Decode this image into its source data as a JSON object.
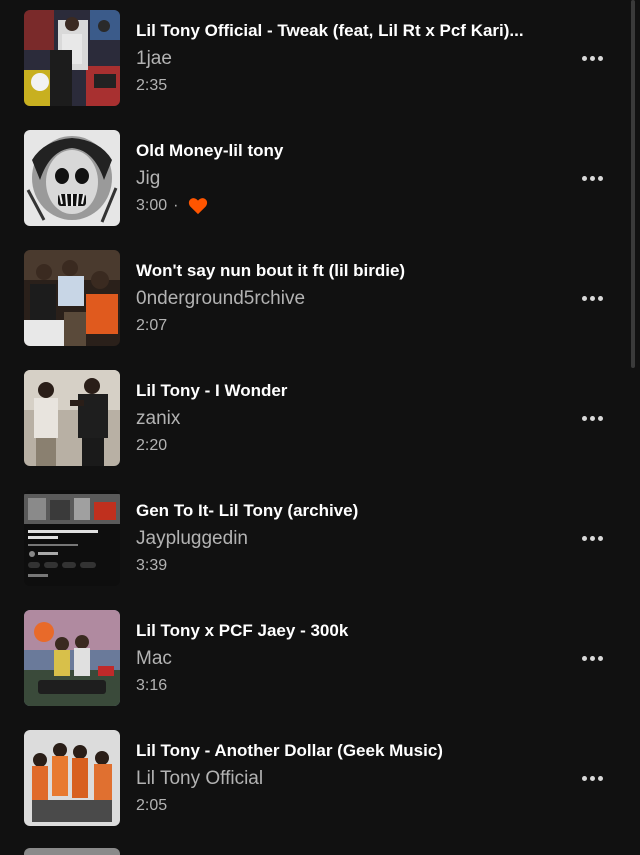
{
  "tracks": [
    {
      "title": "Lil Tony Official - Tweak (feat, Lil Rt x Pcf Kari)...",
      "artist": "1jae",
      "duration": "2:35",
      "liked": false,
      "art_icon": "collage-artwork"
    },
    {
      "title": "Old Money-lil tony",
      "artist": "Jig",
      "duration": "3:00",
      "liked": true,
      "art_icon": "horror-face-artwork"
    },
    {
      "title": "Won't say nun bout it ft (lil birdie)",
      "artist": "0nderground5rchive",
      "duration": "2:07",
      "liked": false,
      "art_icon": "group-photo-artwork"
    },
    {
      "title": "Lil Tony - I Wonder",
      "artist": "zanix",
      "duration": "2:20",
      "liked": false,
      "art_icon": "two-people-photo-artwork"
    },
    {
      "title": "Gen To It- Lil Tony (archive)",
      "artist": "Jaypluggedin",
      "duration": "3:39",
      "liked": false,
      "art_icon": "video-screenshot-artwork"
    },
    {
      "title": "Lil Tony x PCF Jaey - 300k",
      "artist": "Mac",
      "duration": "3:16",
      "liked": false,
      "art_icon": "cartoon-artwork"
    },
    {
      "title": "Lil Tony - Another Dollar (Geek Music)",
      "artist": "Lil Tony Official",
      "duration": "2:05",
      "liked": false,
      "art_icon": "group-orange-artwork"
    }
  ],
  "colors": {
    "background": "#111111",
    "title": "#ffffff",
    "secondary": "#b3b3b3",
    "heart": "#ff5500"
  },
  "icons": {
    "more": "more-options-icon",
    "heart": "heart-icon"
  }
}
